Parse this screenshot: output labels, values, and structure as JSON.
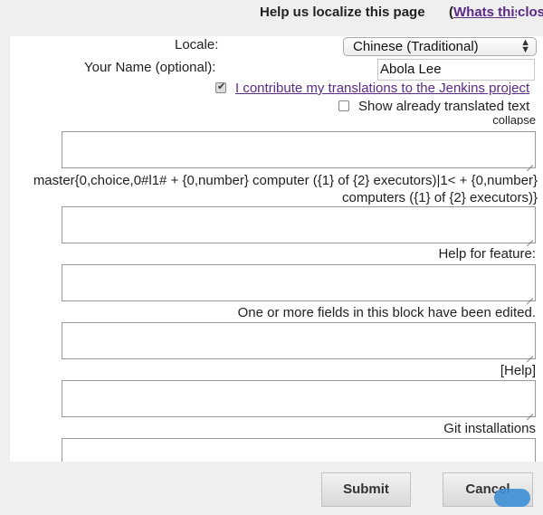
{
  "header": {
    "title": "Help us localize this page",
    "whats_this_prefix": "(",
    "whats_this_link": "Whats this",
    "close_label": "close"
  },
  "form": {
    "locale_label": "Locale:",
    "locale_value": "Chinese (Traditional)",
    "name_label": "Your Name (optional):",
    "name_value": "Abola Lee",
    "contribute_label": "I contribute my translations to the Jenkins project",
    "contribute_checked": true,
    "show_translated_label": "Show already translated text",
    "show_translated_checked": false
  },
  "entries": [
    {
      "label": "collapse"
    },
    {
      "label": "master{0,choice,0#l1# + {0,number} computer ({1} of {2} executors)|1< + {0,number} computers ({1} of {2} executors)}"
    },
    {
      "label": "Help for feature:"
    },
    {
      "label": "One or more fields in this block have been edited."
    },
    {
      "label": "[Help]"
    },
    {
      "label": "Git installations"
    }
  ],
  "footer": {
    "submit_label": "Submit",
    "cancel_label": "Cancel"
  },
  "colors": {
    "link": "#5b2a86",
    "background": "#efefef",
    "panel": "#ffffff"
  }
}
